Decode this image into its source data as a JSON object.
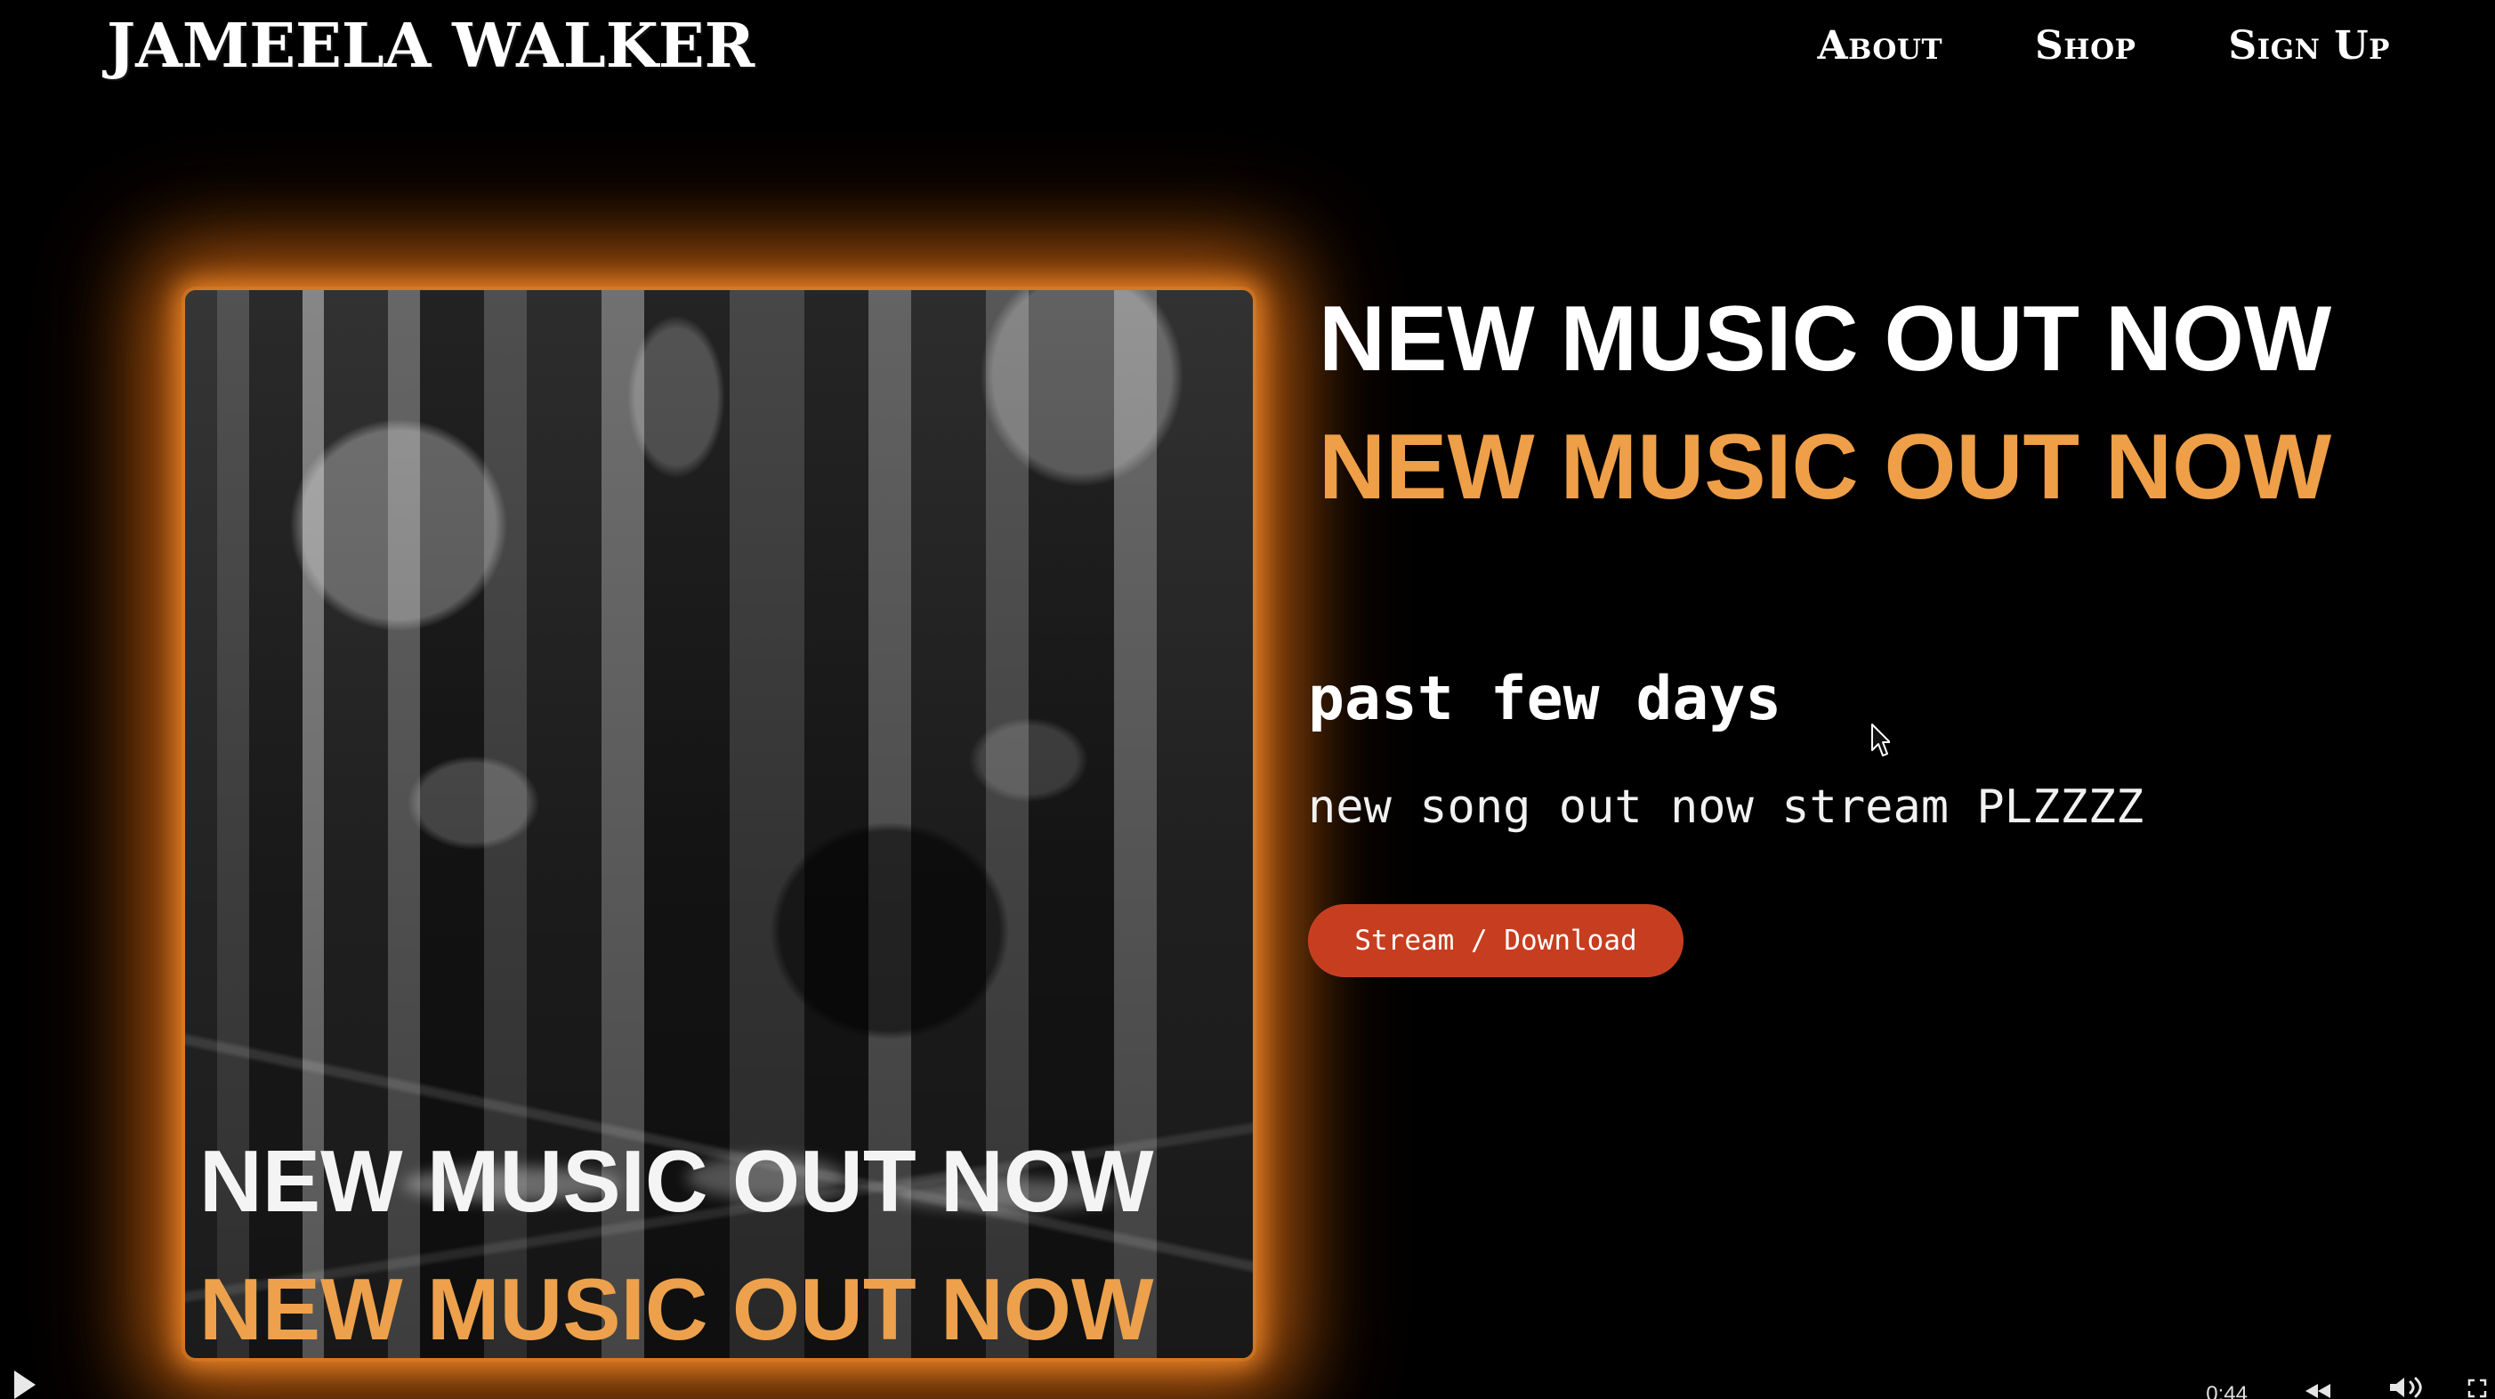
{
  "header": {
    "brand": "JAMEELA WALKER",
    "nav": [
      {
        "label": "About"
      },
      {
        "label": "Shop"
      },
      {
        "label": "Sign Up"
      }
    ]
  },
  "release": {
    "cover_text": [
      "NEW MUSIC OUT NOW",
      "NEW MUSIC OUT NOW"
    ],
    "headline_lines": [
      "NEW MUSIC OUT NOW",
      "NEW MUSIC OUT NOW"
    ],
    "title": "past few days",
    "description": "new song out now stream PLZZZZ",
    "cta_label": "Stream / Download"
  },
  "player": {
    "timestamp": "0:44",
    "icons": [
      "play-icon",
      "rewind-icon",
      "volume-icon",
      "fullscreen-icon"
    ]
  },
  "colors": {
    "background": "#000000",
    "accent_orange": "#ee9f48",
    "button_red": "#c63d1f",
    "text_white": "#ffffff"
  }
}
